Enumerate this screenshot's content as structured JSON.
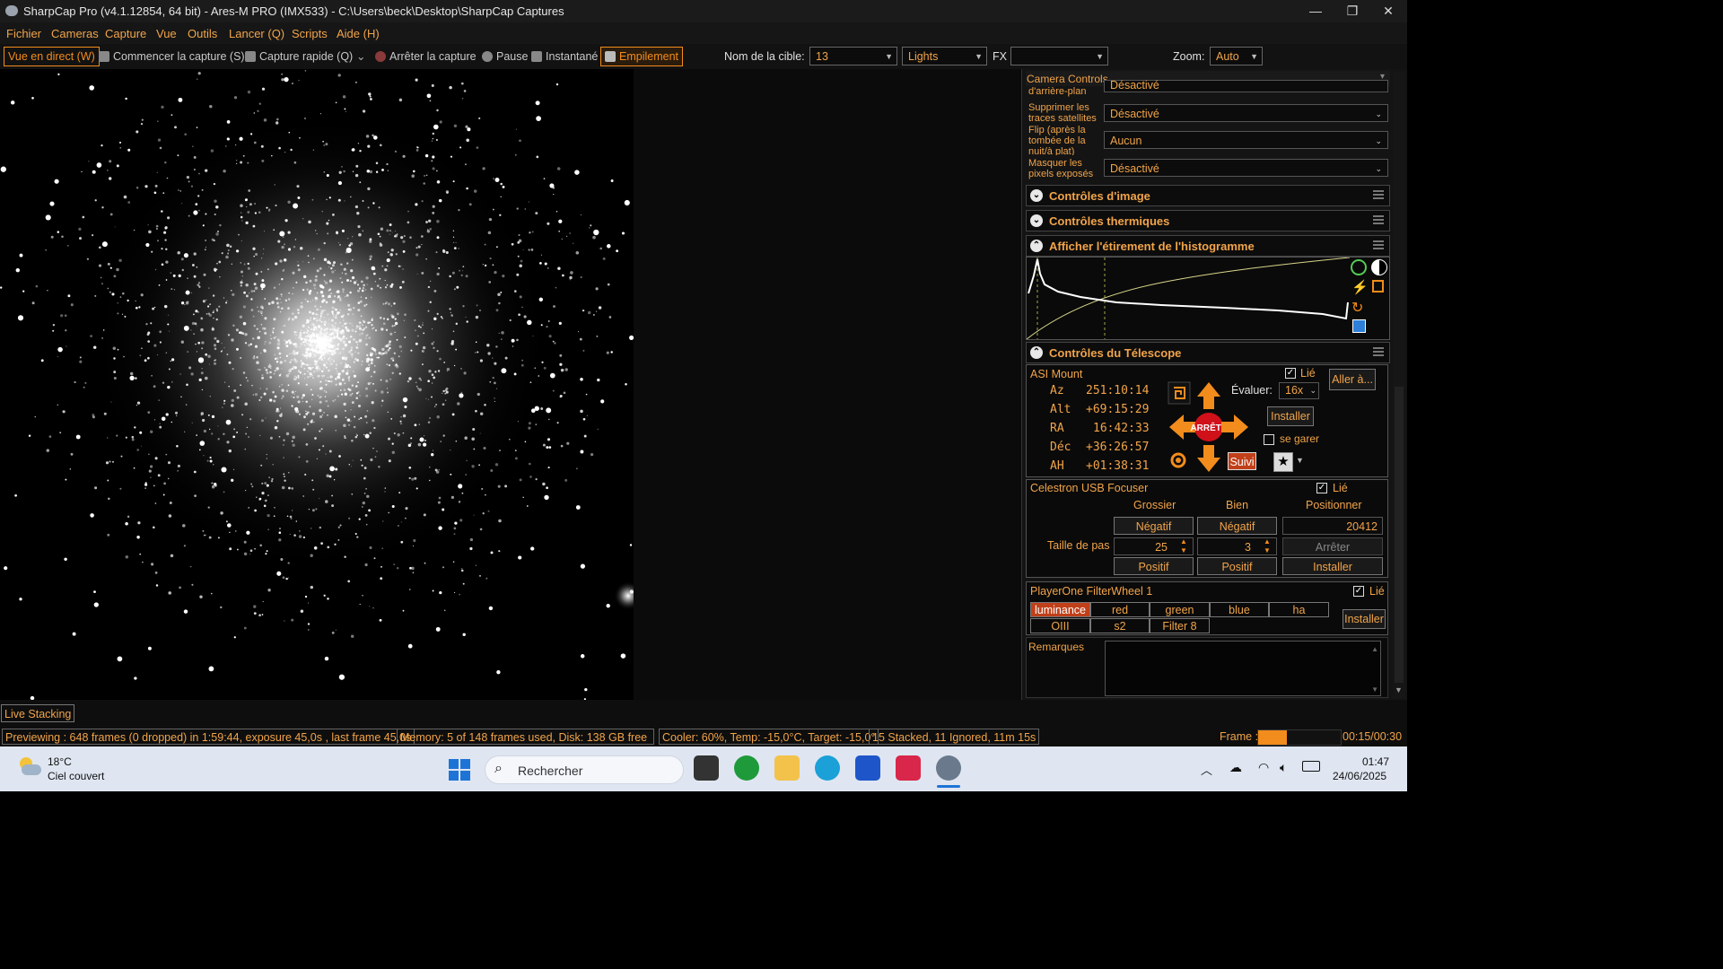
{
  "window": {
    "title": "SharpCap Pro (v4.1.12854, 64 bit) - Ares-M PRO (IMX533) - C:\\Users\\beck\\Desktop\\SharpCap Captures",
    "minimize": "—",
    "maximize": "❐",
    "close": "✕"
  },
  "menu": [
    "Fichier",
    "Cameras",
    "Capture",
    "Vue",
    "Outils",
    "Lancer (Q)",
    "Scripts",
    "Aide (H)"
  ],
  "toolbar": {
    "live_view": "Vue en direct (W)",
    "start_capture": "Commencer la capture (S)",
    "quick_capture": "Capture rapide (Q)",
    "stop_capture": "Arrêter la capture",
    "pause": "Pause",
    "snapshot": "Instantané",
    "stacking": "Empilement",
    "target_label": "Nom de la cible:",
    "target_value": "13",
    "frame_type": "Lights",
    "fx_label": "FX",
    "zoom_label": "Zoom:",
    "zoom_value": "Auto"
  },
  "panel": {
    "header": "Camera Controls",
    "rows": [
      {
        "label": "d'arrière-plan",
        "value": "Désactivé"
      },
      {
        "label": "Supprimer les traces satellites",
        "value": "Désactivé"
      },
      {
        "label": "Flip (après la tombée de la nuit/à plat)",
        "value": "Aucun"
      },
      {
        "label": "Masquer les pixels exposés",
        "value": "Désactivé"
      }
    ],
    "sections": {
      "image": "Contrôles d'image",
      "thermal": "Contrôles thermiques",
      "histogram": "Afficher l'étirement de l'histogramme",
      "telescope": "Contrôles du Télescope"
    }
  },
  "mount": {
    "name": "ASI Mount",
    "linked": "Lié",
    "goto": "Aller à...",
    "rate_label": "Évaluer:",
    "rate_value": "16x",
    "install": "Installer",
    "park": "se garer",
    "stop": "ARRÊTE",
    "tracking": "Suivi",
    "coords": [
      {
        "k": "Az",
        "v": "251:10:14"
      },
      {
        "k": "Alt",
        "v": "+69:15:29"
      },
      {
        "k": "RA",
        "v": "16:42:33"
      },
      {
        "k": "Déc",
        "v": "+36:26:57"
      },
      {
        "k": "AH",
        "v": "+01:38:31"
      }
    ]
  },
  "focuser": {
    "name": "Celestron USB Focuser",
    "linked": "Lié",
    "col_coarse": "Grossier",
    "col_fine": "Bien",
    "col_position": "Positionner",
    "negative": "Négatif",
    "positive": "Positif",
    "position_value": "20412",
    "step_label": "Taille de pas",
    "coarse_step": "25",
    "fine_step": "3",
    "stop": "Arrêter",
    "install": "Installer"
  },
  "filterwheel": {
    "name": "PlayerOne FilterWheel 1",
    "linked": "Lié",
    "filters_row1": [
      "luminance",
      "red",
      "green",
      "blue",
      "ha"
    ],
    "filters_row2": [
      "OIII",
      "s2",
      "Filter 8"
    ],
    "install": "Installer"
  },
  "notes_label": "Remarques",
  "live_stacking_tab": "Live Stacking",
  "status": {
    "preview": "Previewing : 648 frames (0 dropped) in 1:59:44, exposure 45,0s , last frame 45,0s",
    "memory": "Memory: 5 of 148 frames used, Disk: 138 GB free",
    "cooler": "Cooler: 60%, Temp: -15,0°C, Target: -15,0°",
    "stacked": "15 Stacked, 11 Ignored, 11m 15s",
    "frame_label": "Frame :",
    "frame_progress": 0.35,
    "frame_time": "00:15/00:30"
  },
  "taskbar": {
    "temperature": "18°C",
    "weather": "Ciel couvert",
    "search_placeholder": "Rechercher",
    "time": "01:47",
    "date": "24/06/2025"
  },
  "colors": {
    "accent": "#f1a44a",
    "highlight": "#f28c1c",
    "selected_filter": "#c0401a",
    "stop_red": "#d0111a"
  }
}
